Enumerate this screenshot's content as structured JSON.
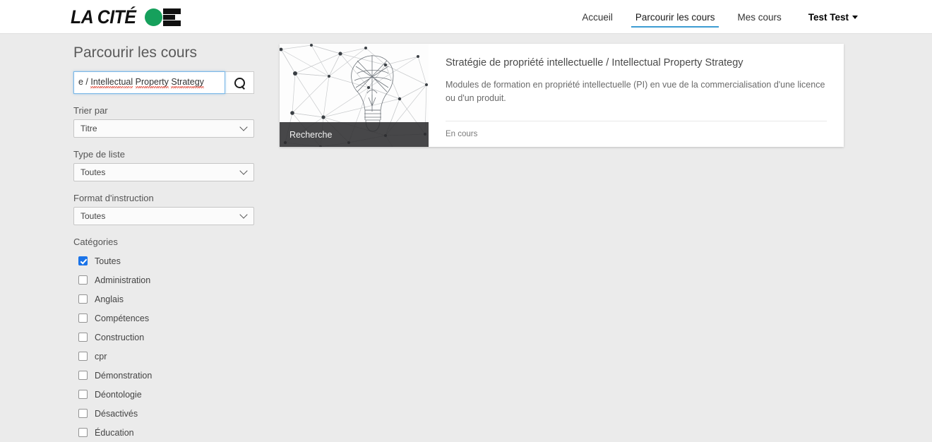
{
  "header": {
    "logo": {
      "text": "LA CITÉ",
      "dot_color": "#16a05c",
      "mark_color": "#111111"
    },
    "nav": [
      {
        "label": "Accueil",
        "active": false
      },
      {
        "label": "Parcourir les cours",
        "active": true
      },
      {
        "label": "Mes cours",
        "active": false
      }
    ],
    "user_menu": {
      "label": "Test Test",
      "caret": "caret-down-icon"
    },
    "accent_color": "#3d9cd2"
  },
  "sidebar": {
    "title": "Parcourir les cours",
    "search": {
      "value": "e / Intellectual Property Strategy",
      "full_value": "Stratégie de propriété intellectuelle / Intellectual Property Strategy",
      "visible_prefix": "e / ",
      "misspelled_words": [
        "Intellectual",
        "Property",
        "Strategy"
      ],
      "button_icon": "search-icon"
    },
    "filters": [
      {
        "label": "Trier par",
        "value": "Titre"
      },
      {
        "label": "Type de liste",
        "value": "Toutes"
      },
      {
        "label": "Format d'instruction",
        "value": "Toutes"
      }
    ],
    "categories_label": "Catégories",
    "categories": [
      {
        "label": "Toutes",
        "checked": true
      },
      {
        "label": "Administration",
        "checked": false
      },
      {
        "label": "Anglais",
        "checked": false
      },
      {
        "label": "Compétences",
        "checked": false
      },
      {
        "label": "Construction",
        "checked": false
      },
      {
        "label": "cpr",
        "checked": false
      },
      {
        "label": "Démonstration",
        "checked": false
      },
      {
        "label": "Déontologie",
        "checked": false
      },
      {
        "label": "Désactivés",
        "checked": false
      },
      {
        "label": "Éducation",
        "checked": false
      }
    ]
  },
  "results": {
    "cards": [
      {
        "media_tag": "Recherche",
        "media_icon": "lightbulb-network-image",
        "title": "Stratégie de propriété intellectuelle / Intellectual Property Strategy",
        "description": "Modules de formation en propriété intellectuelle (PI) en vue de la commercialisation d'une licence ou d'un produit.",
        "status": "En cours"
      }
    ]
  }
}
